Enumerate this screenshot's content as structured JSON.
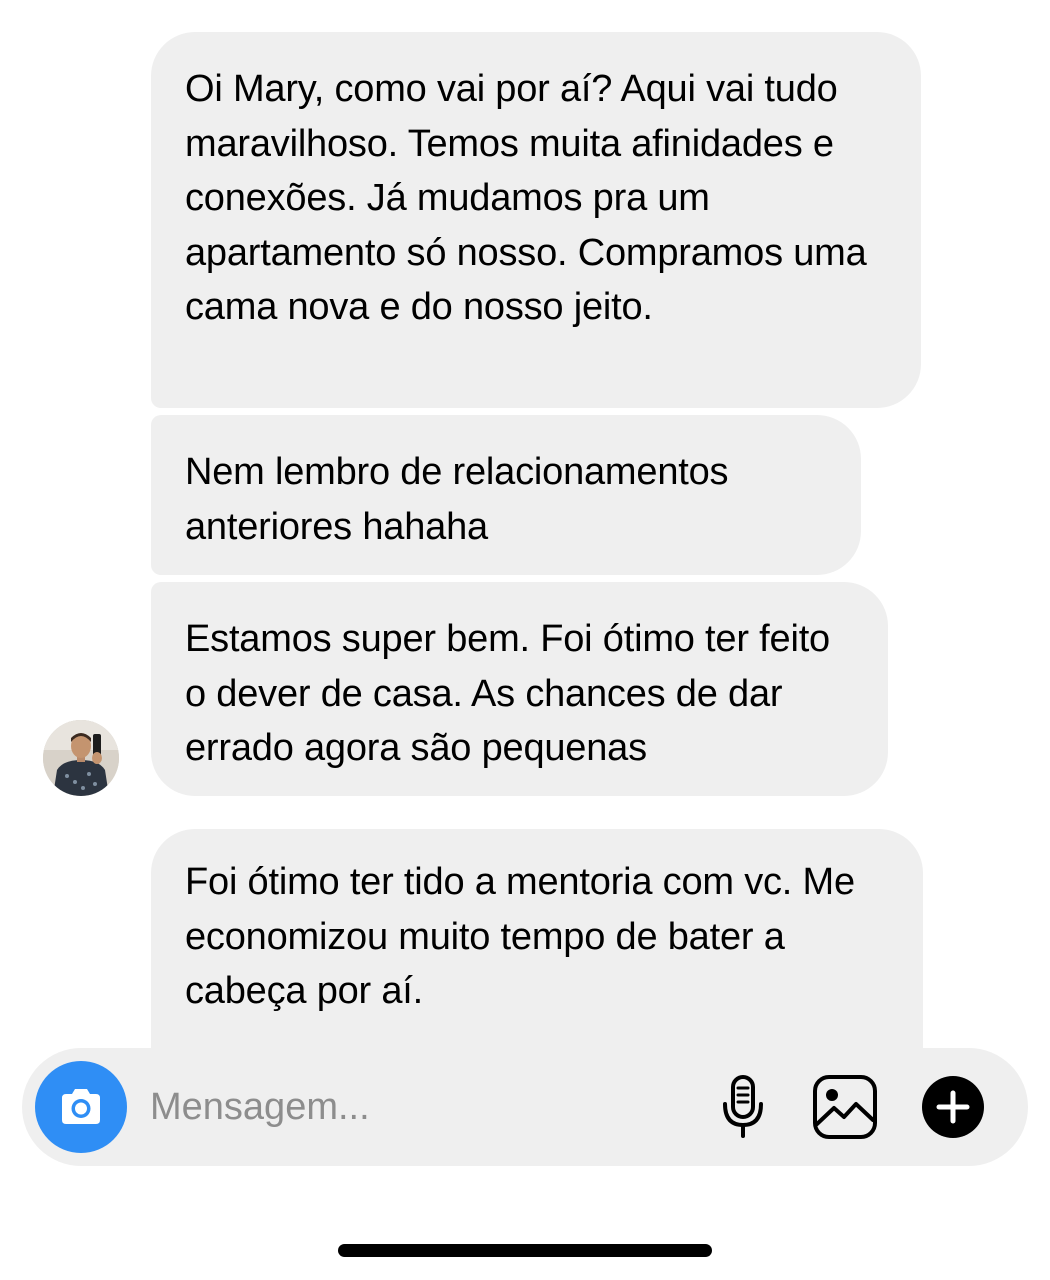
{
  "messages": [
    {
      "text": "Oi Mary, como vai por aí? Aqui vai tudo maravilhoso. Temos muita afinidades e conexões. Já mudamos pra um apartamento só nosso. Compramos uma cama nova e do nosso jeito."
    },
    {
      "text": "Nem lembro de relacionamentos anteriores hahaha"
    },
    {
      "text": "Estamos super bem. Foi ótimo ter feito o dever de casa. As chances de dar errado agora são pequenas"
    },
    {
      "text": "Foi ótimo ter tido a mentoria com vc. Me economizou muito tempo de bater a cabeça por aí."
    }
  ],
  "composer": {
    "placeholder": "Mensagem...",
    "value": "",
    "camera_icon": "camera-icon",
    "mic_icon": "microphone-icon",
    "gallery_icon": "gallery-icon",
    "plus_icon": "plus-icon"
  },
  "colors": {
    "bubble": "#efefef",
    "accent": "#2f8ef5",
    "placeholder": "#8d8d8d"
  }
}
